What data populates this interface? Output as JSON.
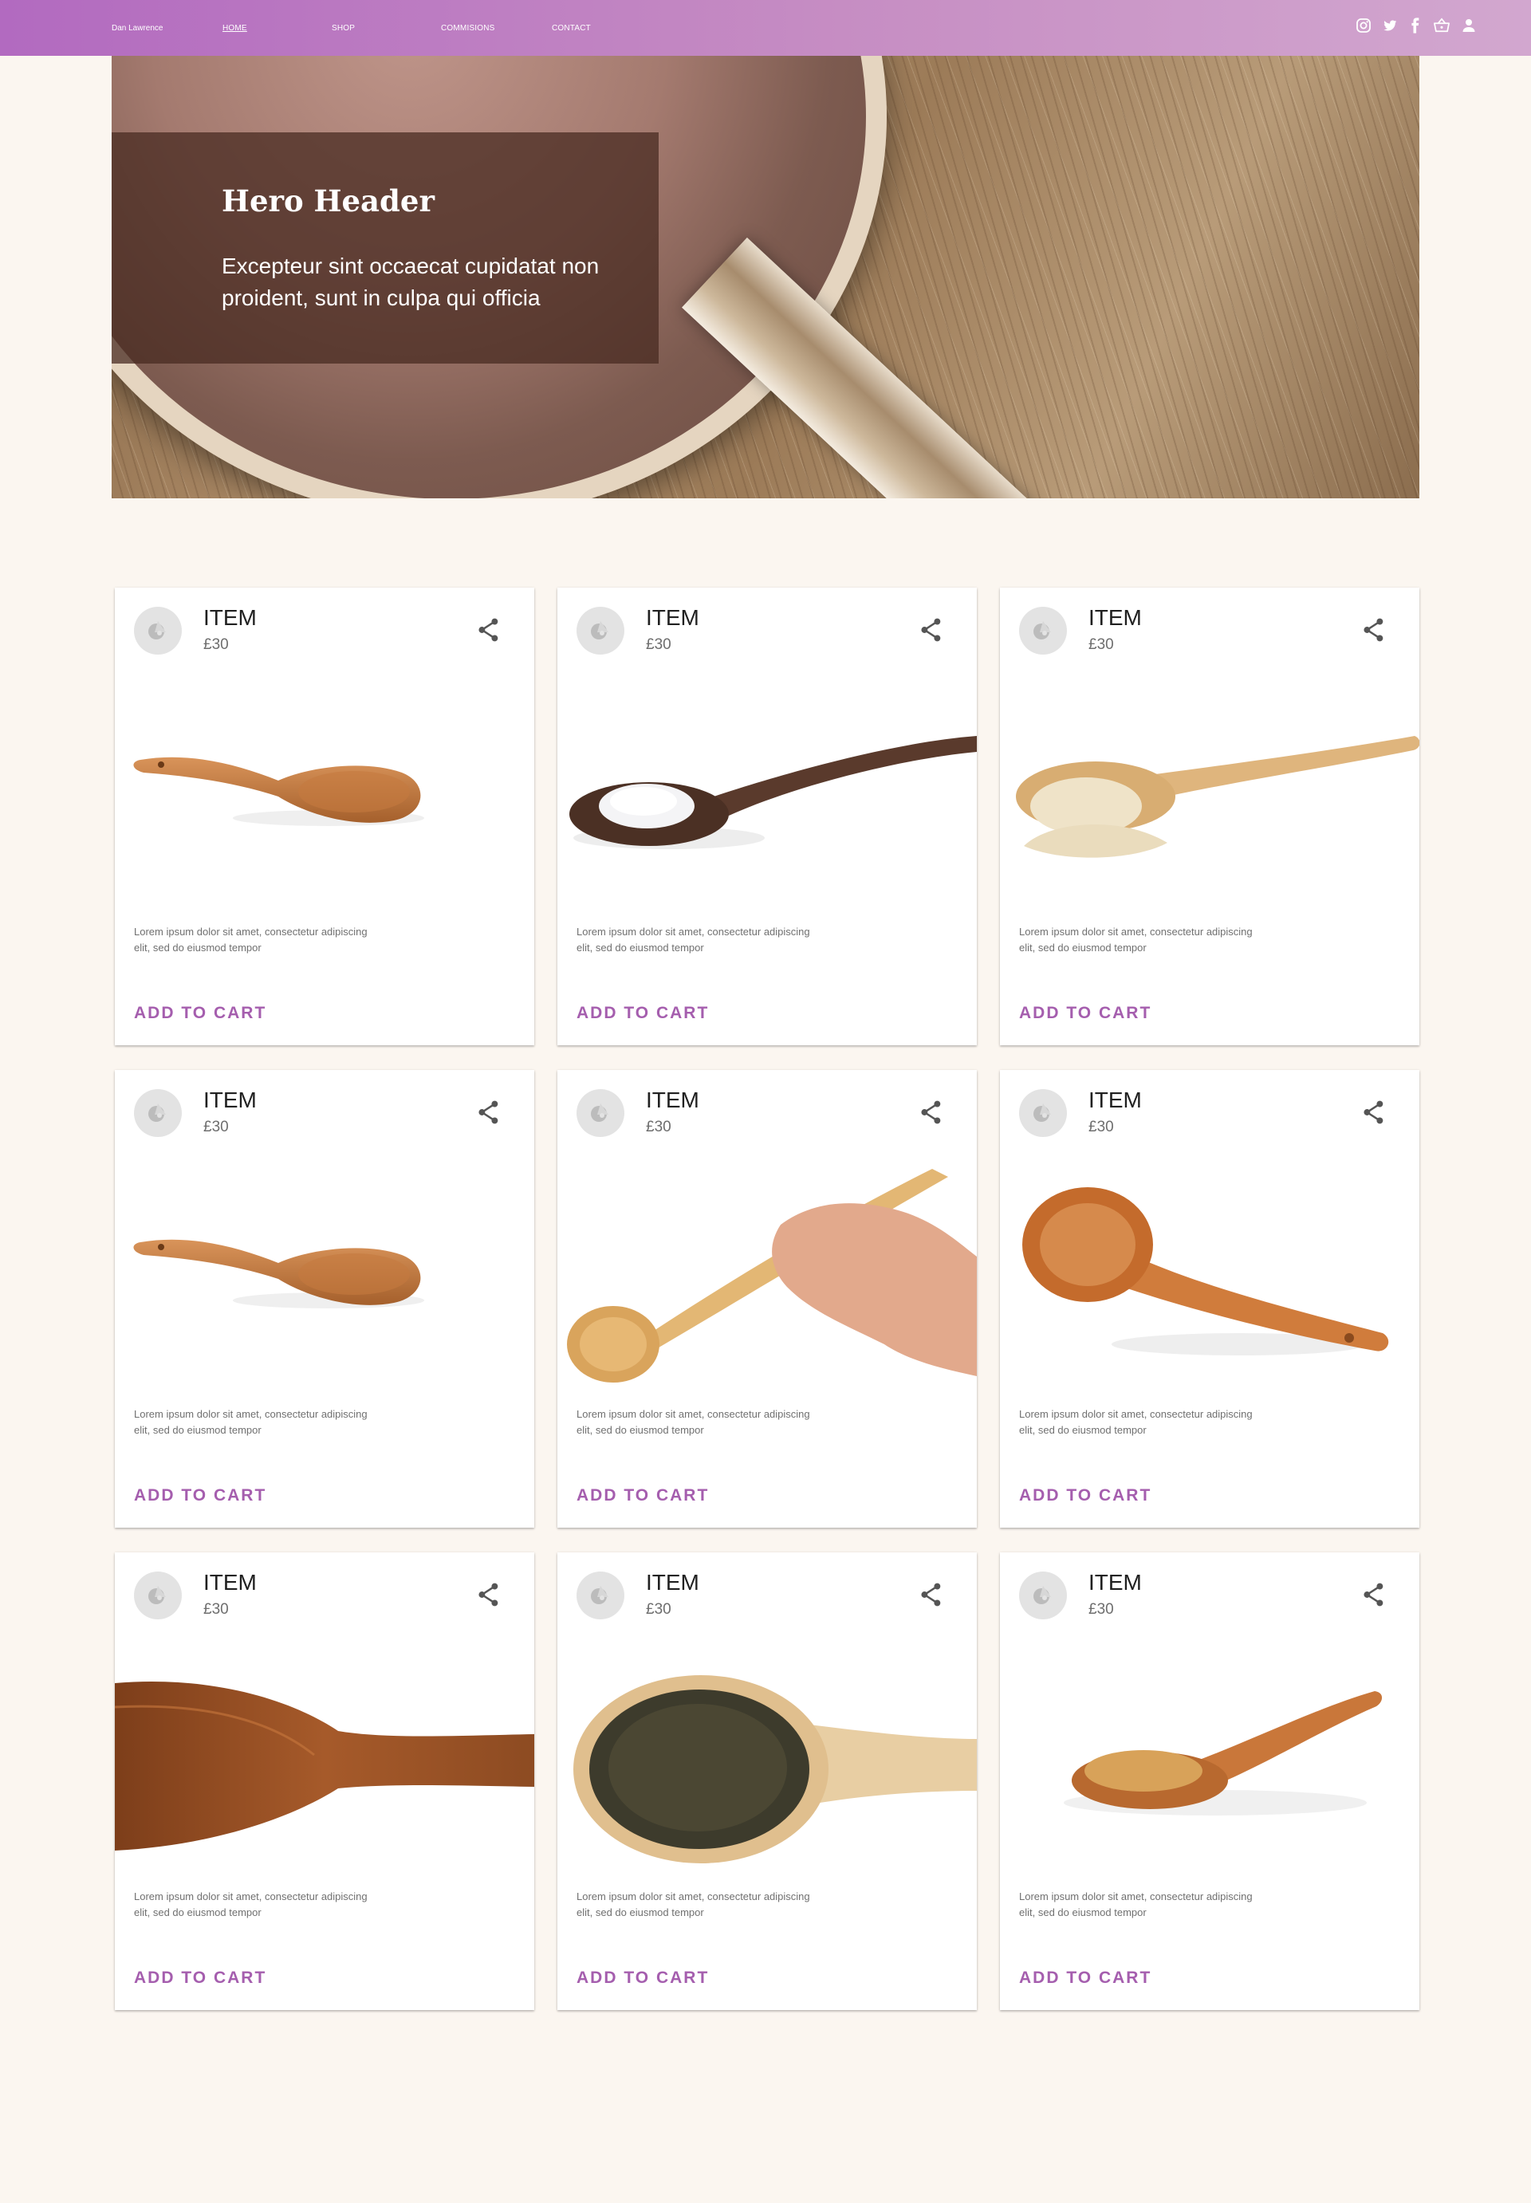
{
  "nav": {
    "brand": "Dan Lawrence",
    "links": [
      "HOME",
      "SHOP",
      "COMMISIONS",
      "CONTACT"
    ],
    "icons": [
      "instagram-icon",
      "twitter-icon",
      "facebook-icon",
      "basket-icon",
      "user-icon"
    ]
  },
  "hero": {
    "title": "Hero Header",
    "subtitle": "Excepteur sint occaecat cupidatat non proident, sunt in culpa qui officia"
  },
  "products": [
    {
      "title": "ITEM",
      "price": "£30",
      "description": "Lorem ipsum dolor sit amet, consectetur adipiscing elit, sed do eiusmod tempor",
      "cta": "ADD TO CART",
      "image": "wooden-spoon"
    },
    {
      "title": "ITEM",
      "price": "£30",
      "description": "Lorem ipsum dolor sit amet, consectetur adipiscing elit, sed do eiusmod tempor",
      "cta": "ADD TO CART",
      "image": "spoon-with-salt"
    },
    {
      "title": "ITEM",
      "price": "£30",
      "description": "Lorem ipsum dolor sit amet, consectetur adipiscing elit, sed do eiusmod tempor",
      "cta": "ADD TO CART",
      "image": "spoon-with-flour"
    },
    {
      "title": "ITEM",
      "price": "£30",
      "description": "Lorem ipsum dolor sit amet, consectetur adipiscing elit, sed do eiusmod tempor",
      "cta": "ADD TO CART",
      "image": "wooden-spoon"
    },
    {
      "title": "ITEM",
      "price": "£30",
      "description": "Lorem ipsum dolor sit amet, consectetur adipiscing elit, sed do eiusmod tempor",
      "cta": "ADD TO CART",
      "image": "hand-holding-spoon"
    },
    {
      "title": "ITEM",
      "price": "£30",
      "description": "Lorem ipsum dolor sit amet, consectetur adipiscing elit, sed do eiusmod tempor",
      "cta": "ADD TO CART",
      "image": "wooden-ladle"
    },
    {
      "title": "ITEM",
      "price": "£30",
      "description": "Lorem ipsum dolor sit amet, consectetur adipiscing elit, sed do eiusmod tempor",
      "cta": "ADD TO CART",
      "image": "wooden-spoon-closeup"
    },
    {
      "title": "ITEM",
      "price": "£30",
      "description": "Lorem ipsum dolor sit amet, consectetur adipiscing elit, sed do eiusmod tempor",
      "cta": "ADD TO CART",
      "image": "spoon-with-tea-leaves"
    },
    {
      "title": "ITEM",
      "price": "£30",
      "description": "Lorem ipsum dolor sit amet, consectetur adipiscing elit, sed do eiusmod tempor",
      "cta": "ADD TO CART",
      "image": "spoon-with-sugar"
    }
  ],
  "colors": {
    "nav_start": "#b26ac0",
    "nav_end": "#d2a7cf",
    "background": "#fbf6f0",
    "accent": "#a55eae"
  }
}
